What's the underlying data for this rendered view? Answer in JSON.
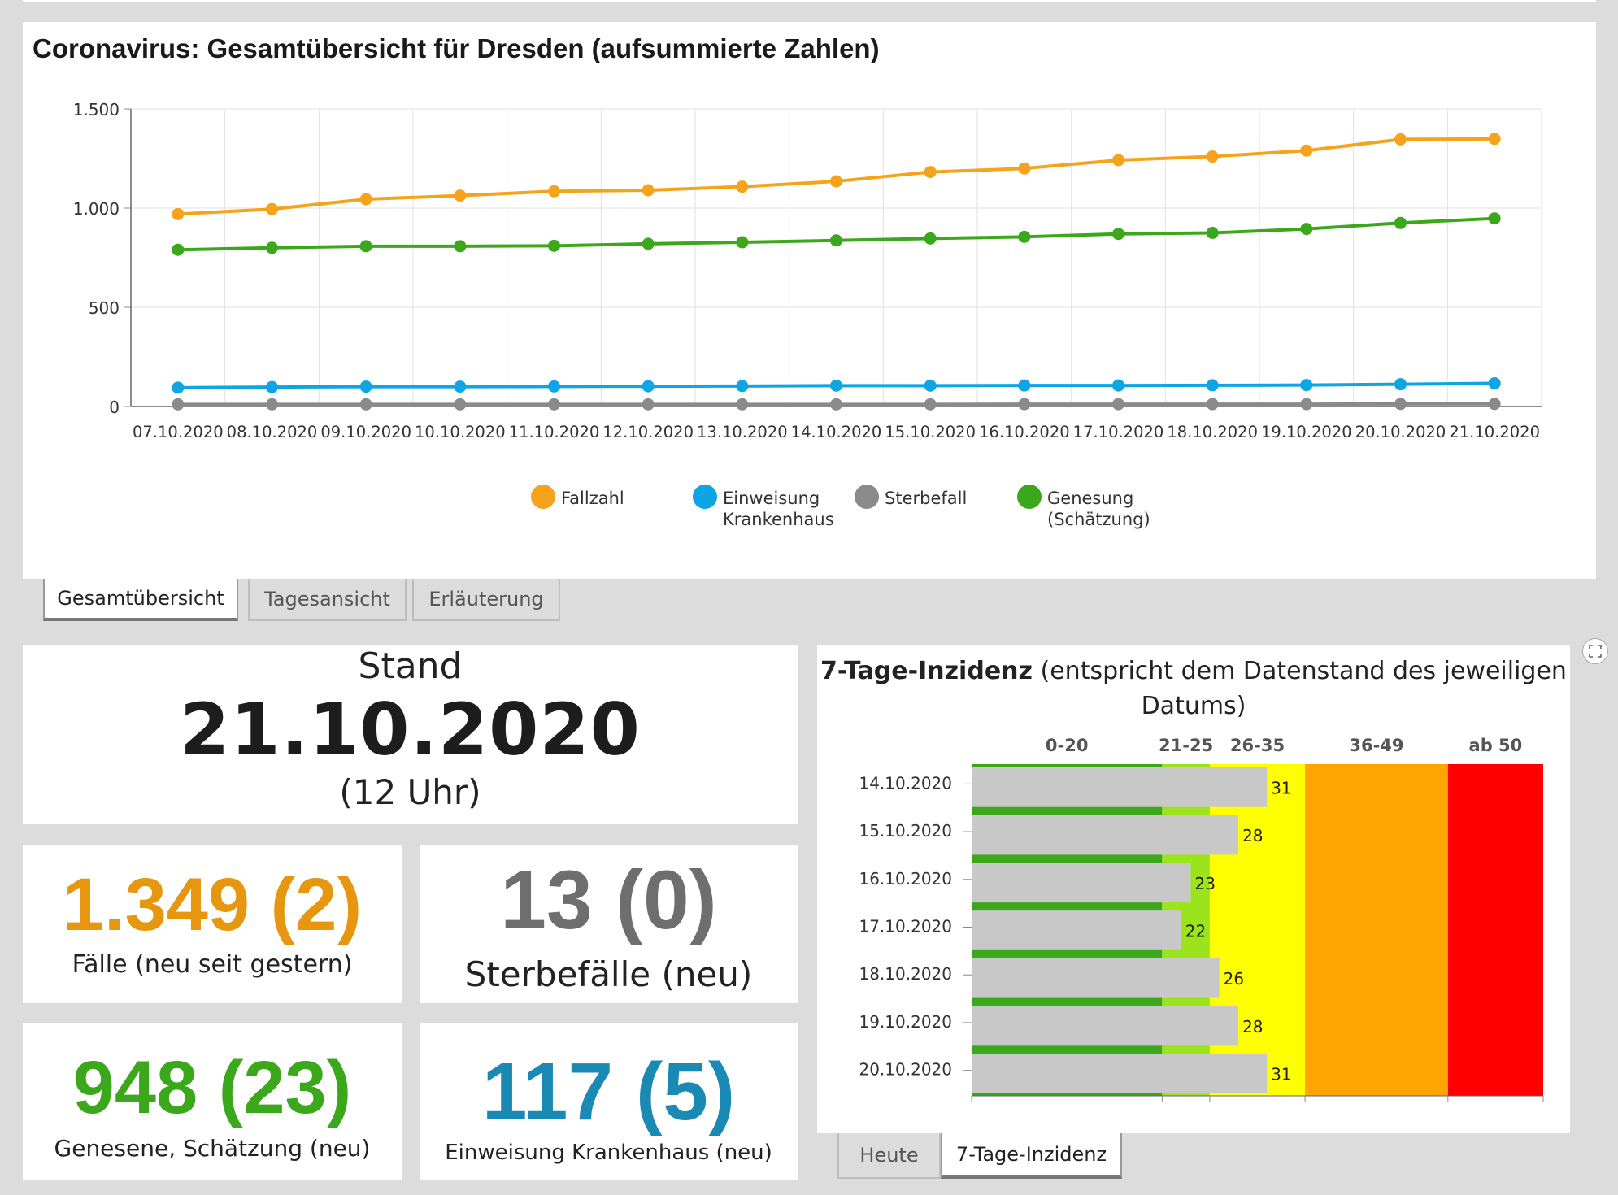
{
  "chart_title": "Coronavirus: Gesamtübersicht für Dresden (aufsummierte Zahlen)",
  "tabs": [
    "Gesamtübersicht",
    "Tagesansicht",
    "Erläuterung"
  ],
  "chart_data": [
    {
      "type": "line",
      "title": "Coronavirus: Gesamtübersicht für Dresden (aufsummierte Zahlen)",
      "x": [
        "07.10.2020",
        "08.10.2020",
        "09.10.2020",
        "10.10.2020",
        "11.10.2020",
        "12.10.2020",
        "13.10.2020",
        "14.10.2020",
        "15.10.2020",
        "16.10.2020",
        "17.10.2020",
        "18.10.2020",
        "19.10.2020",
        "20.10.2020",
        "21.10.2020"
      ],
      "ylim": [
        0,
        1500
      ],
      "yticks": [
        0,
        500,
        1000,
        1500
      ],
      "ytick_labels": [
        "0",
        "500",
        "1.000",
        "1.500"
      ],
      "grid": true,
      "legend_position": "bottom",
      "series": [
        {
          "name": "Fallzahl",
          "color": "#f5a31a",
          "values": [
            970,
            995,
            1045,
            1063,
            1085,
            1090,
            1108,
            1135,
            1182,
            1200,
            1242,
            1260,
            1290,
            1347,
            1349
          ]
        },
        {
          "name": "Einweisung Krankenhaus",
          "color": "#0ea5e4",
          "values": [
            95,
            98,
            100,
            100,
            101,
            102,
            103,
            105,
            105,
            106,
            106,
            107,
            108,
            112,
            117
          ]
        },
        {
          "name": "Sterbefall",
          "color": "#8a8a8a",
          "values": [
            11,
            11,
            11,
            11,
            11,
            11,
            11,
            11,
            11,
            12,
            12,
            12,
            12,
            13,
            13
          ]
        },
        {
          "name": "Genesung (Schätzung)",
          "color": "#3aa81a",
          "values": [
            790,
            800,
            808,
            808,
            810,
            820,
            828,
            837,
            847,
            855,
            870,
            875,
            895,
            925,
            948
          ]
        }
      ],
      "legend_lines": [
        [
          "Fallzahl"
        ],
        [
          "Einweisung",
          "Krankenhaus"
        ],
        [
          "Sterbefall"
        ],
        [
          "Genesung",
          "(Schätzung)"
        ]
      ]
    },
    {
      "type": "bar",
      "title": "7-Tage-Inzidenz (entspricht dem Datenstand des jeweiligen Datums)",
      "orientation": "horizontal",
      "categories": [
        "14.10.2020",
        "15.10.2020",
        "16.10.2020",
        "17.10.2020",
        "18.10.2020",
        "19.10.2020",
        "20.10.2020"
      ],
      "values": [
        31,
        28,
        23,
        22,
        26,
        28,
        31
      ],
      "bands": [
        {
          "label": "0-20",
          "from": 0,
          "to": 20,
          "color": "#3aa81a"
        },
        {
          "label": "21-25",
          "from": 20,
          "to": 25,
          "color": "#9be31a"
        },
        {
          "label": "26-35",
          "from": 25,
          "to": 35,
          "color": "#ffff00"
        },
        {
          "label": "36-49",
          "from": 35,
          "to": 50,
          "color": "#ffa500"
        },
        {
          "label": "ab 50",
          "from": 50,
          "to": 60,
          "color": "#ff0000"
        }
      ],
      "xlim": [
        0,
        60
      ],
      "bar_color": "#c8c8c8"
    }
  ],
  "stand": {
    "label": "Stand",
    "date": "21.10.2020",
    "time": "(12 Uhr)"
  },
  "stats": {
    "cases": {
      "value": "1.349 (2)",
      "label": "Fälle (neu seit gestern)",
      "color": "#e6960f"
    },
    "deaths": {
      "value": "13 (0)",
      "label": "Sterbefälle (neu)",
      "color": "#6e6e6e"
    },
    "recovered": {
      "value": "948 (23)",
      "label": "Genesene, Schätzung (neu)",
      "color": "#3aa81a"
    },
    "hospital": {
      "value": "117 (5)",
      "label": "Einweisung Krankenhaus (neu)",
      "color": "#1a8ab4"
    }
  },
  "inz": {
    "title_bold": "7-Tage-Inzidenz",
    "title_rest": " (entspricht dem Datenstand des jeweiligen Datums)"
  },
  "bottom_tabs": [
    "Heute",
    "7-Tage-Inzidenz"
  ],
  "icons": {
    "expand": "expand-icon"
  }
}
